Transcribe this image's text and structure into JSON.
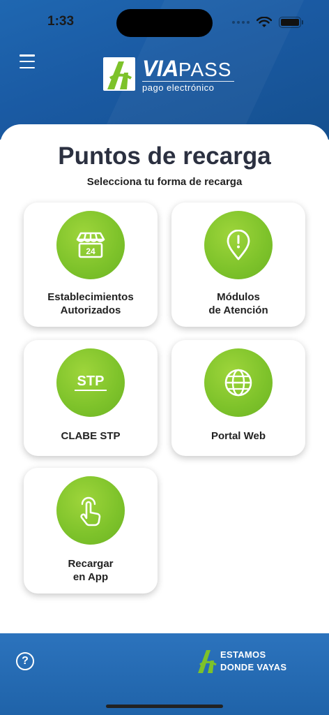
{
  "status_bar": {
    "time": "1:33"
  },
  "header": {
    "logo_via": "VIA",
    "logo_pass": "PASS",
    "logo_tagline": "pago electrónico"
  },
  "page": {
    "title": "Puntos de recarga",
    "subtitle": "Selecciona tu forma de recarga"
  },
  "options": [
    {
      "line1": "Establecimientos",
      "line2": "Autorizados",
      "icon": "store-24-icon"
    },
    {
      "line1": "Módulos",
      "line2": "de Atención",
      "icon": "location-alert-icon"
    },
    {
      "line1": "CLABE STP",
      "line2": "",
      "icon": "stp-icon",
      "icon_text": "STP"
    },
    {
      "line1": "Portal Web",
      "line2": "",
      "icon": "globe-icon"
    },
    {
      "line1": "Recargar",
      "line2": "en App",
      "icon": "tap-hand-icon"
    }
  ],
  "footer": {
    "slogan_line1": "ESTAMOS",
    "slogan_line2": "DONDE VAYAS"
  },
  "colors": {
    "brand_blue": "#1a5aa3",
    "accent_green": "#7dc22a",
    "footer_blue": "#2c73bd"
  }
}
